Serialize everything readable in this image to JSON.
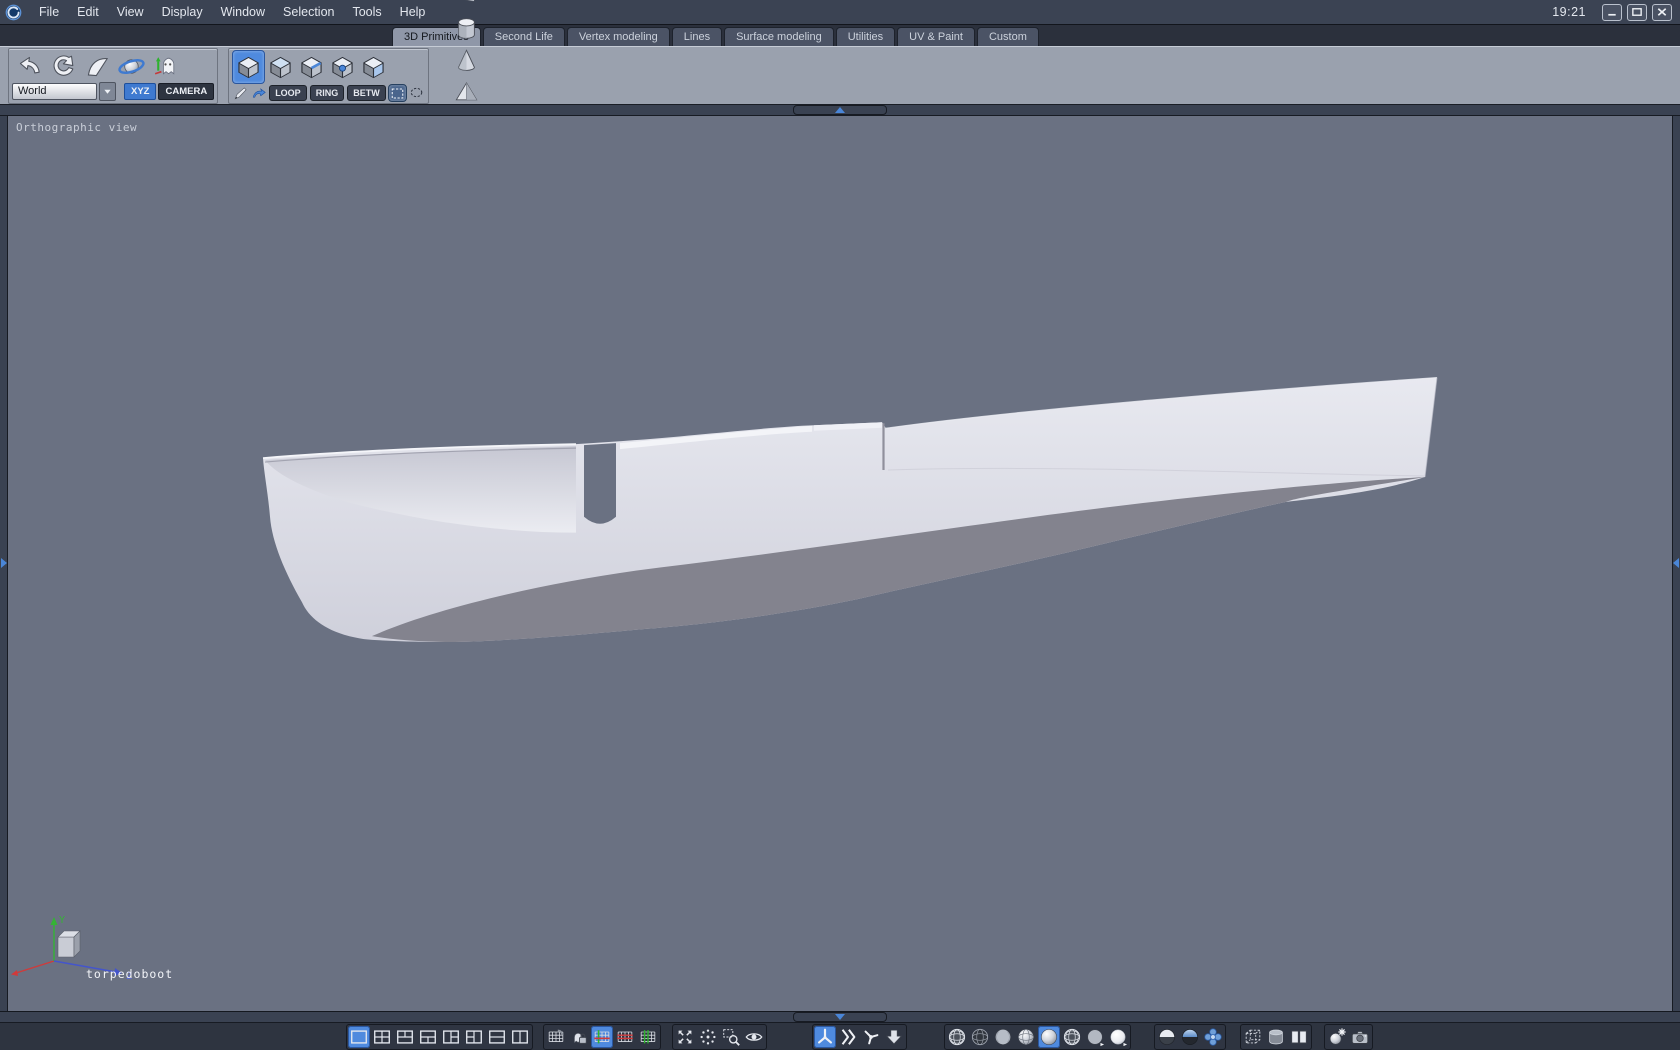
{
  "window": {
    "time": "19:21",
    "controls": [
      {
        "name": "minimize-button",
        "glyph": "winmin"
      },
      {
        "name": "maximize-button",
        "glyph": "winmax"
      },
      {
        "name": "close-button",
        "glyph": "winclose"
      }
    ]
  },
  "menu": {
    "items": [
      {
        "label": "File",
        "name": "menu-file"
      },
      {
        "label": "Edit",
        "name": "menu-edit"
      },
      {
        "label": "View",
        "name": "menu-view"
      },
      {
        "label": "Display",
        "name": "menu-display"
      },
      {
        "label": "Window",
        "name": "menu-window"
      },
      {
        "label": "Selection",
        "name": "menu-selection"
      },
      {
        "label": "Tools",
        "name": "menu-tools"
      },
      {
        "label": "Help",
        "name": "menu-help"
      }
    ]
  },
  "tabs": {
    "items": [
      {
        "label": "3D Primitives",
        "name": "tab-3d-primitives",
        "active": true
      },
      {
        "label": "Second Life",
        "name": "tab-second-life"
      },
      {
        "label": "Vertex modeling",
        "name": "tab-vertex-modeling"
      },
      {
        "label": "Lines",
        "name": "tab-lines"
      },
      {
        "label": "Surface modeling",
        "name": "tab-surface-modeling"
      },
      {
        "label": "Utilities",
        "name": "tab-utilities"
      },
      {
        "label": "UV & Paint",
        "name": "tab-uv-paint"
      },
      {
        "label": "Custom",
        "name": "tab-custom"
      }
    ]
  },
  "toolbar": {
    "history": [
      {
        "name": "undo-icon",
        "glyph": "undo"
      },
      {
        "name": "redo-icon",
        "glyph": "redo"
      },
      {
        "name": "pan-view-icon",
        "glyph": "pan"
      },
      {
        "name": "orbit-view-icon",
        "glyph": "orbit"
      },
      {
        "name": "ghost-mode-icon",
        "glyph": "ghost"
      }
    ],
    "world_value": "World",
    "space_buttons": [
      {
        "label": "XYZ",
        "name": "xyz-space-button",
        "active": true
      },
      {
        "label": "CAMERA",
        "name": "camera-space-button"
      }
    ],
    "selection_modes": [
      {
        "name": "select-object-icon",
        "glyph": "cube",
        "active": true
      },
      {
        "name": "select-face-icon",
        "glyph": "cube2"
      },
      {
        "name": "select-edge-icon",
        "glyph": "cubeedge"
      },
      {
        "name": "select-point-icon",
        "glyph": "cubepoint"
      },
      {
        "name": "select-element-icon",
        "glyph": "cubeface"
      }
    ],
    "selection_tools_left": [
      {
        "name": "paint-selection-icon",
        "glyph": "pen"
      },
      {
        "name": "grow-selection-icon",
        "glyph": "bluearrow"
      }
    ],
    "selection_buttons": [
      {
        "label": "LOOP",
        "name": "loop-button"
      },
      {
        "label": "RING",
        "name": "ring-button"
      },
      {
        "label": "BETW",
        "name": "between-button"
      }
    ],
    "selection_tools_right": [
      {
        "name": "rectangle-select-icon",
        "glyph": "marquee",
        "active": true
      },
      {
        "name": "lasso-select-icon",
        "glyph": "lasso"
      }
    ],
    "primitives": [
      {
        "name": "primitive-cube-icon",
        "glyph": "cube"
      },
      {
        "name": "primitive-sphere-icon",
        "glyph": "sphere"
      },
      {
        "name": "primitive-facet-icon",
        "glyph": "facet"
      },
      {
        "name": "primitive-grid-icon",
        "glyph": "gridp"
      },
      {
        "name": "primitive-cylinder-icon",
        "glyph": "cylinder"
      },
      {
        "name": "primitive-cone-icon",
        "glyph": "cone"
      },
      {
        "name": "primitive-pyramid-icon",
        "glyph": "pyramid"
      },
      {
        "name": "primitive-diamond-icon",
        "glyph": "diamond"
      },
      {
        "name": "primitive-icosahedron-icon",
        "glyph": "icosa"
      },
      {
        "name": "primitive-dodecahedron-icon",
        "glyph": "dodeca"
      },
      {
        "name": "primitive-geodesic-icon",
        "glyph": "geo"
      },
      {
        "name": "primitive-text-icon",
        "glyph": "text3d"
      }
    ]
  },
  "viewport": {
    "view_label": "Orthographic view",
    "object_name": "torpedoboot",
    "background_color": "#6a7182",
    "axis": {
      "y_label": "Y",
      "z_label": "Z",
      "x_color": "#d03a3a",
      "y_color": "#35b335",
      "z_color": "#4455cc"
    }
  },
  "bottom": {
    "layouts": [
      {
        "name": "layout-single-icon",
        "glyph": "lay1",
        "active": true
      },
      {
        "name": "layout-quad-icon",
        "glyph": "lay2"
      },
      {
        "name": "layout-two-top-one-bottom-icon",
        "glyph": "lay3"
      },
      {
        "name": "layout-one-top-two-bottom-icon",
        "glyph": "lay4"
      },
      {
        "name": "layout-one-left-two-right-icon",
        "glyph": "lay5"
      },
      {
        "name": "layout-two-left-one-right-icon",
        "glyph": "lay6"
      },
      {
        "name": "layout-two-rows-icon",
        "glyph": "lay7"
      },
      {
        "name": "layout-two-columns-icon",
        "glyph": "lay8"
      }
    ],
    "grid_group": [
      {
        "name": "grid-snap-icon",
        "glyph": "gridsnap"
      },
      {
        "name": "snap-lock-icon",
        "glyph": "ghostlock"
      },
      {
        "name": "grid-xy-toggle-icon",
        "glyph": "gridxy",
        "active": true
      },
      {
        "name": "grid-horizontal-icon",
        "glyph": "gridx"
      },
      {
        "name": "grid-vertical-icon",
        "glyph": "gridy"
      }
    ],
    "view_group": [
      {
        "name": "fit-view-icon",
        "glyph": "fit"
      },
      {
        "name": "orbit-dots-icon",
        "glyph": "dots"
      },
      {
        "name": "zoom-area-icon",
        "glyph": "zoomrect"
      },
      {
        "name": "look-at-eye-icon",
        "glyph": "eye"
      }
    ],
    "manip_group": [
      {
        "name": "universal-manipulator-icon",
        "glyph": "jack",
        "active": true
      },
      {
        "name": "translate-arrows-icon",
        "glyph": "karrows"
      },
      {
        "name": "rotate-jack-icon",
        "glyph": "jack2"
      },
      {
        "name": "collapse-arrow-icon",
        "glyph": "dropdn"
      }
    ],
    "shading_group": [
      {
        "name": "wireframe-sphere-icon",
        "glyph": "swire"
      },
      {
        "name": "hidden-line-sphere-icon",
        "glyph": "swire2"
      },
      {
        "name": "flat-shaded-sphere-icon",
        "glyph": "sflat"
      },
      {
        "name": "shaded-wireframe-sphere-icon",
        "glyph": "sshadewire"
      },
      {
        "name": "smooth-shaded-sphere-icon",
        "glyph": "ssmooth",
        "active": true
      },
      {
        "name": "wire-overlay-sphere-icon",
        "glyph": "swire"
      },
      {
        "name": "matte-sphere-icon",
        "glyph": "sflat2"
      },
      {
        "name": "bright-sphere-icon",
        "glyph": "sbright"
      }
    ],
    "smooth_group": [
      {
        "name": "half-smooth-sphere-icon",
        "glyph": "shalf"
      },
      {
        "name": "smoothing-dome-icon",
        "glyph": "sdome"
      },
      {
        "name": "subdivision-icon",
        "glyph": "flower"
      }
    ],
    "display_group": [
      {
        "name": "wireframe-box-icon",
        "glyph": "wirecube"
      },
      {
        "name": "backface-cylinder-icon",
        "glyph": "cylseg"
      },
      {
        "name": "dual-view-icon",
        "glyph": "book"
      }
    ],
    "render_group": [
      {
        "name": "light-icon",
        "glyph": "lightico"
      },
      {
        "name": "render-camera-icon",
        "glyph": "camico"
      }
    ]
  },
  "colors": {
    "accent_blue": "#4a86d8",
    "toolbar_bg": "#9aa1ae",
    "bar_dark": "#2e3440",
    "menubar_bg": "#3b4353",
    "viewport_bg": "#6a7182",
    "hull_light": "#e6e7ee",
    "hull_shadow": "#83838e"
  }
}
